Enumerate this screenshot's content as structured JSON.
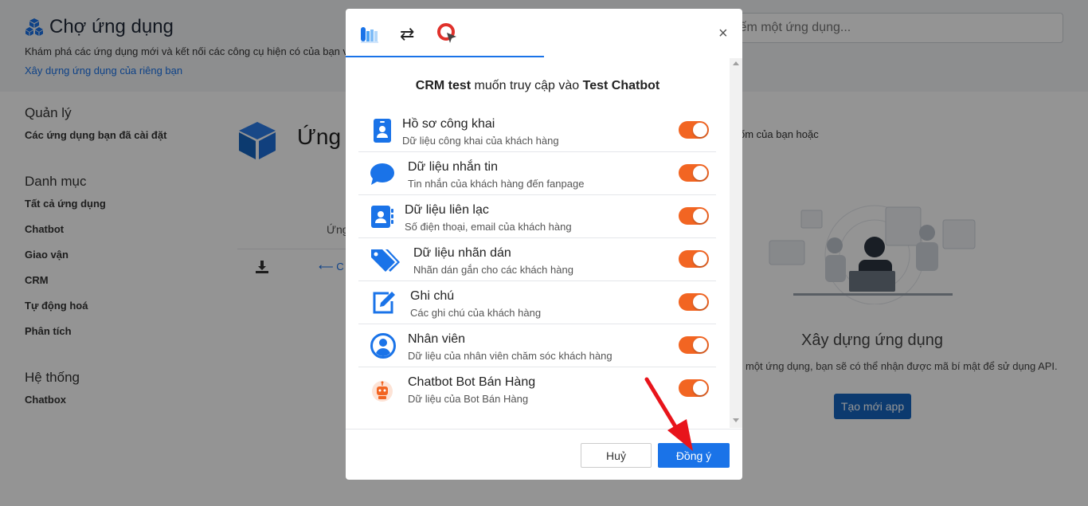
{
  "header": {
    "title": "Chợ ứng dụng",
    "description": "Khám phá các ứng dụng mới và kết nối các công cụ hiện có của bạn vớ",
    "build_link": "Xây dựng ứng dụng của riêng bạn",
    "search_placeholder": "iếm một ứng dụng..."
  },
  "sidebar": {
    "manage": {
      "heading": "Quản lý",
      "items": [
        "Các ứng dụng bạn đã cài đặt"
      ]
    },
    "category": {
      "heading": "Danh mục",
      "items": [
        "Tất cả ứng dụng",
        "Chatbot",
        "Giao vận",
        "CRM",
        "Tự động hoá",
        "Phân tích"
      ]
    },
    "system": {
      "heading": "Hệ thống",
      "items": [
        "Chatbox"
      ]
    }
  },
  "main": {
    "heading": "Ứng",
    "column_label": "Ứng",
    "back_text": "⟵ C",
    "right_text_top": "ốm của bạn hoặc",
    "build_title": "Xây dựng ứng dụng",
    "build_desc": "một ứng dụng, bạn sẽ có thể nhận được mã bí mật để sử dụng API.",
    "create_button": "Tạo mới app"
  },
  "modal": {
    "swap_glyph": "⇄",
    "close_glyph": "×",
    "access": {
      "requester": "CRM test",
      "verb": " muốn truy cập vào ",
      "target": "Test Chatbot"
    },
    "permissions": [
      {
        "icon": "id-card-icon",
        "title": "Hồ sơ công khai",
        "subtitle": "Dữ liệu công khai của khách hàng",
        "enabled": true
      },
      {
        "icon": "chat-bubble-icon",
        "title": "Dữ liệu nhắn tin",
        "subtitle": "Tin nhắn của khách hàng đến fanpage",
        "enabled": true
      },
      {
        "icon": "contact-book-icon",
        "title": "Dữ liệu liên lạc",
        "subtitle": "Số điện thoại, email của khách hàng",
        "enabled": true
      },
      {
        "icon": "tags-icon",
        "title": "Dữ liệu nhãn dán",
        "subtitle": "Nhãn dán gắn cho các khách hàng",
        "enabled": true
      },
      {
        "icon": "edit-note-icon",
        "title": "Ghi chú",
        "subtitle": "Các ghi chú của khách hàng",
        "enabled": true
      },
      {
        "icon": "user-circle-icon",
        "title": "Nhân viên",
        "subtitle": "Dữ liệu của nhân viên chăm sóc khách hàng",
        "enabled": true
      },
      {
        "icon": "robot-icon",
        "title": "Chatbot Bot Bán Hàng",
        "subtitle": "Dữ liệu của Bot Bán Hàng",
        "enabled": true
      }
    ],
    "cancel_label": "Huỷ",
    "confirm_label": "Đồng ý"
  },
  "colors": {
    "accent": "#1a73e8",
    "toggle_on": "#f26522",
    "create_button": "#1565c0",
    "annotation_arrow": "#e8141b"
  }
}
